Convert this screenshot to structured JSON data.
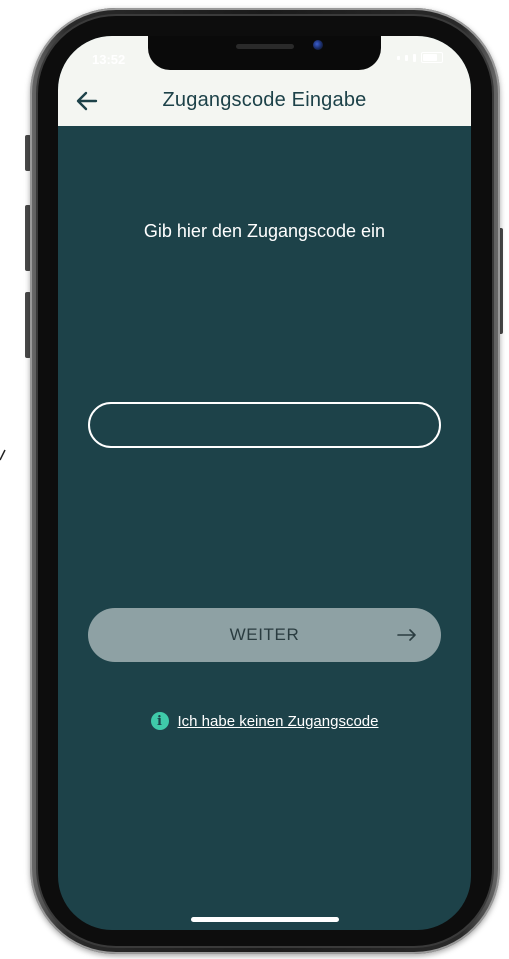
{
  "status_bar": {
    "time": "13:52"
  },
  "header": {
    "title": "Zugangscode Eingabe",
    "back_icon": "arrow-left-icon"
  },
  "main": {
    "prompt": "Gib hier den Zugangscode ein",
    "code_input": {
      "value": "",
      "placeholder": ""
    },
    "next_button": {
      "label": "WEITER",
      "icon": "arrow-right-icon"
    },
    "help_link": {
      "icon": "info-icon",
      "label": "Ich habe keinen Zugangscode"
    }
  },
  "colors": {
    "background": "#1d4249",
    "header_bg": "#f4f6f2",
    "button_bg": "#8ea1a4",
    "accent": "#3fcaa9",
    "text_light": "#ffffff"
  }
}
